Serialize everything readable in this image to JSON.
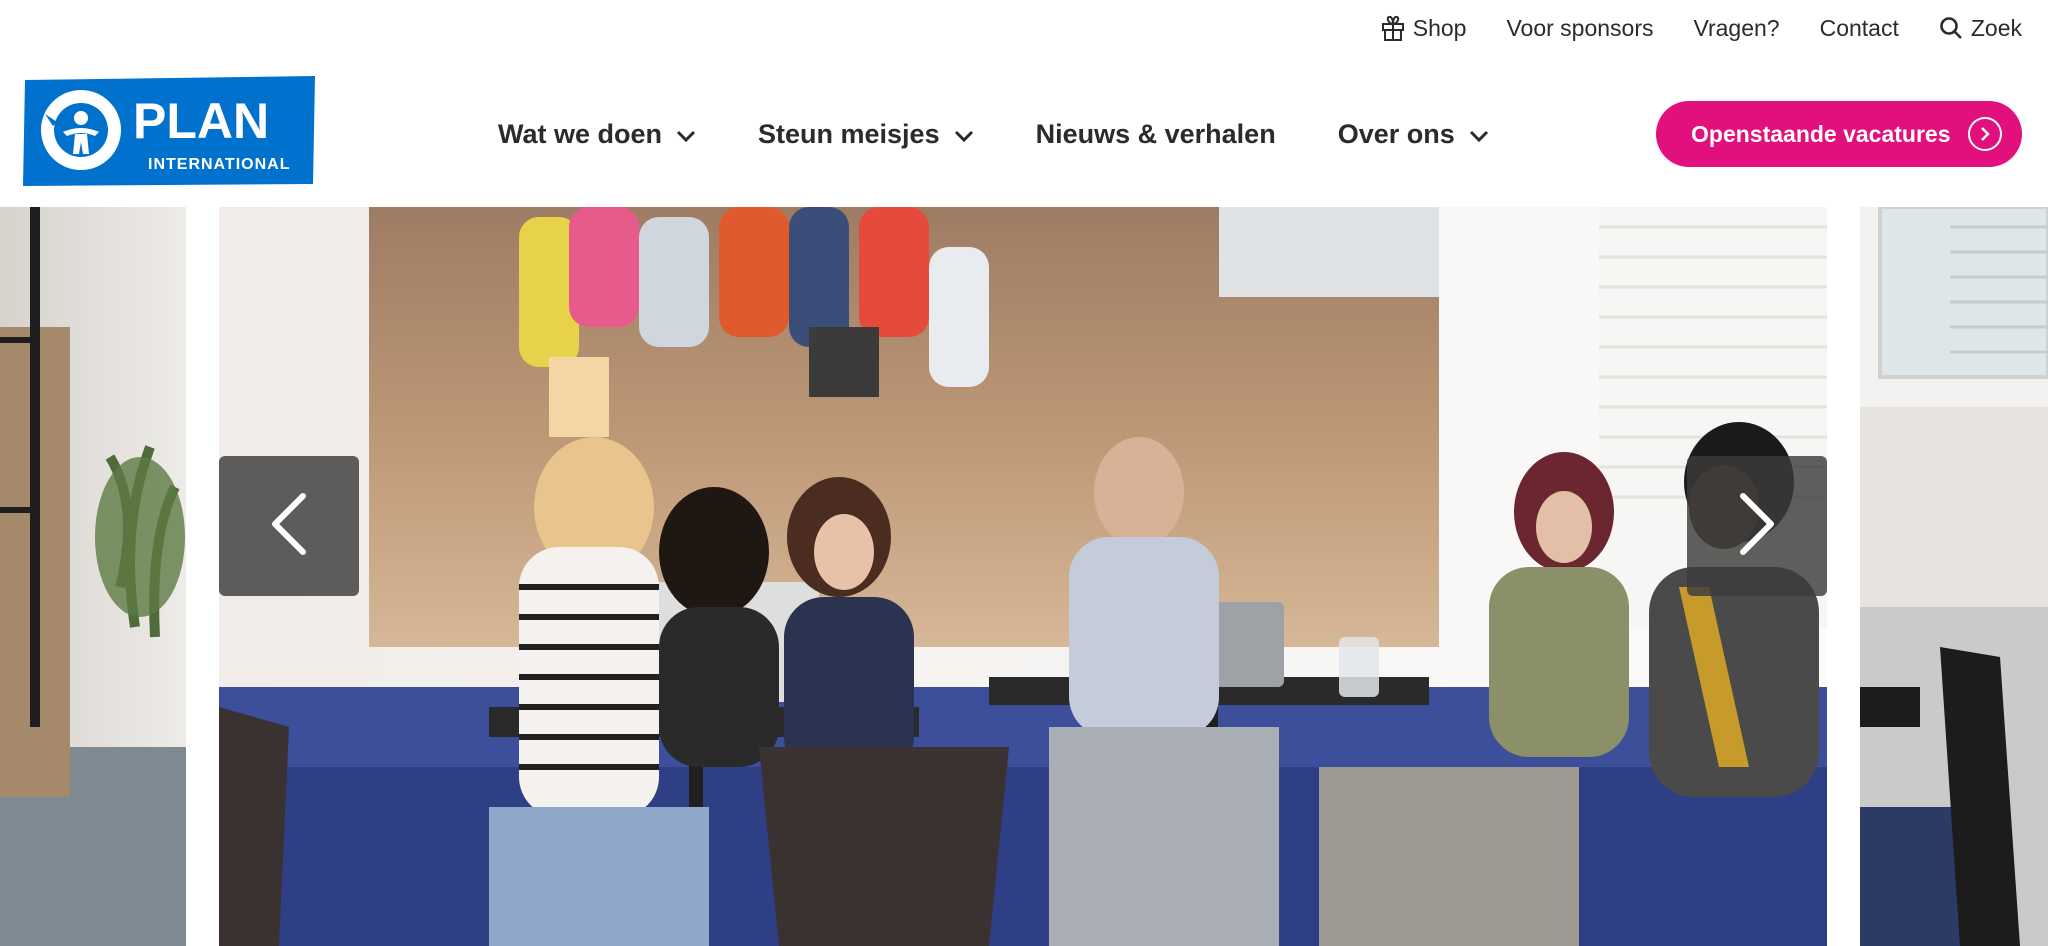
{
  "utility_nav": {
    "shop": "Shop",
    "sponsors": "Voor sponsors",
    "questions": "Vragen?",
    "contact": "Contact",
    "search": "Zoek"
  },
  "logo": {
    "brand": "PLAN",
    "sub": "INTERNATIONAL",
    "color": "#0072ce"
  },
  "main_nav": {
    "items": [
      {
        "label": "Wat we doen",
        "has_dropdown": true
      },
      {
        "label": "Steun meisjes",
        "has_dropdown": true
      },
      {
        "label": "Nieuws & verhalen",
        "has_dropdown": false
      },
      {
        "label": "Over ons",
        "has_dropdown": true
      }
    ]
  },
  "cta": {
    "label": "Openstaande vacatures",
    "color": "#e2107d"
  },
  "carousel": {
    "prev_icon": "chevron-left-icon",
    "next_icon": "chevron-right-icon"
  }
}
